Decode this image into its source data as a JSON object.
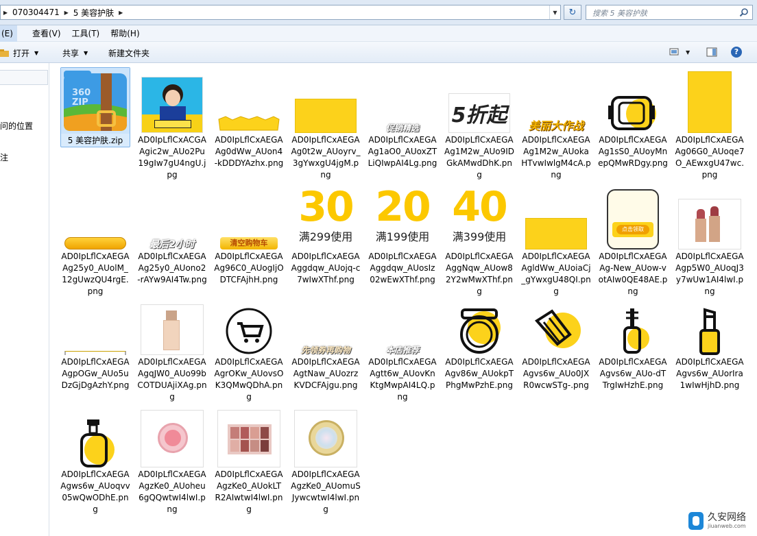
{
  "address": {
    "crumbs": [
      "070304471",
      "5 美容护肤"
    ],
    "search_placeholder": "搜索 5 美容护肤"
  },
  "menu": [
    "(E)",
    "查看(V)",
    "工具(T)",
    "帮助(H)"
  ],
  "commands": {
    "open": "打开",
    "share": "共享",
    "new_folder": "新建文件夹"
  },
  "nav": {
    "item1": "问的位置",
    "item2": "注"
  },
  "files": [
    {
      "name": "5 美容护肤.zip",
      "kind": "zip"
    },
    {
      "name": "AD0IpLflCxACGAAgic2w_AUo2Pu19gIw7gU4ngU.jpg",
      "kind": "photo"
    },
    {
      "name": "AD0IpLflCxAEGAAg0dWw_AUon4-kDDDYAzhx.png",
      "kind": "banner"
    },
    {
      "name": "AD0IpLflCxAEGAAg0t2w_AUoyrv_3gYwxgU4jgM.png",
      "kind": "yellow"
    },
    {
      "name": "AD0IpLflCxAEGAAg1aO0_AUoxZTLiQIwpAI4Lg.png",
      "kind": "tag",
      "text": "促销精选"
    },
    {
      "name": "AD0IpLflCxAEGAAg1M2w_AUo9IDGkAMwdDhK.png",
      "kind": "discount",
      "text": "5折起"
    },
    {
      "name": "AD0IpLflCxAEGAAg1M2w_AUokaHTvwIwlgM4cA.png",
      "kind": "campaign",
      "text": "美丽大作战"
    },
    {
      "name": "AD0IpLflCxAEGAAg1sS0_AUoyMnepQMwRDgy.png",
      "kind": "icon-mask"
    },
    {
      "name": "AD0IpLflCxAEGAAg06G0_AEwxgU47wc.png",
      "kind": "yellow-tall",
      "display": "AD0IpLflCxAEGAAg06G0_AUoqe7O_AEwxgU47wc.png"
    },
    {
      "name": "AD0IpLflCxAEGAAg25y0_AUolM_12gUwzQU4rgE.png",
      "kind": "pill"
    },
    {
      "name": "AD0IpLflCxAEGAAg25y0_AUono2-rAYw9AI4Tw.png",
      "kind": "tag2",
      "text": "最后2小时"
    },
    {
      "name": "AD0IpLflCxAEGAAg96C0_AUogIjODTCFAjhH.png",
      "kind": "cartbtn",
      "text": "清空购物车"
    },
    {
      "name": "AD0IpLflCxAEGAAggdqw_AUojq-c7wIwXThf.png",
      "kind": "coupon",
      "big": "30",
      "sub": "满299使用"
    },
    {
      "name": "AD0IpLflCxAEGAAggdqw_AUosIz02wEwXThf.png",
      "kind": "coupon",
      "big": "20",
      "sub": "满199使用"
    },
    {
      "name": "AD0IpLflCxAEGAAggNqw_AUow82Y2wMwXThf.png",
      "kind": "coupon",
      "big": "40",
      "sub": "满399使用"
    },
    {
      "name": "AD0IpLflCxAEGAAgldWw_AUoiaCj_gYwxgU48QI.png",
      "kind": "yellow"
    },
    {
      "name": "AD0IpLflCxAEGAAg-New_AUow-votAIw0QE48AE.png",
      "kind": "ticket",
      "text": "点击领取"
    },
    {
      "name": "AD0IpLflCxAEGAAgp5W0_AUoqJ3y7wUw1AI4lwI.png",
      "kind": "lipstick"
    },
    {
      "name": "AD0IpLflCxAEGAAgpOGw_AUo5uDzGjDgAzhY.png",
      "kind": "line"
    },
    {
      "name": "AD0IpLflCxAEGAAgqJW0_AUo99bCOTDUAjiXAg.png",
      "kind": "foundation"
    },
    {
      "name": "AD0IpLflCxAEGAAgrOKw_AUovsOK3QMwQDhA.png",
      "kind": "cart"
    },
    {
      "name": "AD0IpLflCxAEGAAgtNaw_AUozrzKVDCFAjgu.png",
      "kind": "tag",
      "text": "先领券再购物"
    },
    {
      "name": "AD0IpLflCxAEGAAgtt6w_AUovKnKtgMwpAI4LQ.png",
      "kind": "tag",
      "text": "本店推荐"
    },
    {
      "name": "AD0IpLflCxAEGAAgv86w_AUokpTPhgMwPzhE.png",
      "kind": "icon-compact"
    },
    {
      "name": "AD0IpLflCxAEGAAgvs6w_AUo0JXR0wcwSTg-.png",
      "kind": "icon-brush"
    },
    {
      "name": "AD0IpLflCxAEGAAgvs6w_AUo-dTTrgIwHzhE.png",
      "kind": "icon-mascara"
    },
    {
      "name": "AD0IpLflCxAEGAAgvs6w_AUorIra1wIwHjhD.png",
      "kind": "icon-lipstick"
    },
    {
      "name": "AD0IpLflCxAEGAAgws6w_AUoqvv05wQwODhE.png",
      "kind": "icon-bottle"
    },
    {
      "name": "AD0IpLflCxAEGAAgzKe0_AUoheu6gQQwtwI4lwI.png",
      "kind": "blush"
    },
    {
      "name": "AD0IpLflCxAEGAAgzKe0_AUokLTR2AIwtwI4lwI.png",
      "kind": "palette"
    },
    {
      "name": "AD0IpLflCxAEGAAgzKe0_AUomuSJywcwtwI4lwI.png",
      "kind": "highlighter"
    }
  ],
  "watermark": {
    "brand": "久安网络",
    "domain": "jiuanweb.com"
  }
}
